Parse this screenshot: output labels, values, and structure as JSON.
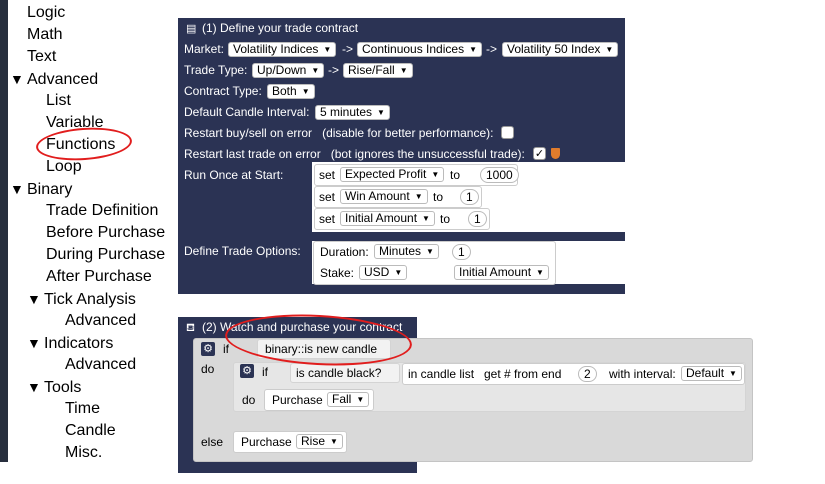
{
  "toolbox": {
    "items": [
      {
        "label": "Logic",
        "arrow": ""
      },
      {
        "label": "Math",
        "arrow": ""
      },
      {
        "label": "Text",
        "arrow": ""
      },
      {
        "label": "Advanced",
        "arrow": "▼"
      },
      {
        "label": "List",
        "arrow": ""
      },
      {
        "label": "Variable",
        "arrow": ""
      },
      {
        "label": "Functions",
        "arrow": ""
      },
      {
        "label": "Loop",
        "arrow": ""
      },
      {
        "label": "Binary",
        "arrow": "▼"
      },
      {
        "label": "Trade Definition",
        "arrow": ""
      },
      {
        "label": "Before Purchase",
        "arrow": ""
      },
      {
        "label": "During Purchase",
        "arrow": ""
      },
      {
        "label": "After Purchase",
        "arrow": ""
      },
      {
        "label": "Tick Analysis",
        "arrow": "▼"
      },
      {
        "label": "Advanced",
        "arrow": ""
      },
      {
        "label": "Indicators",
        "arrow": "▼"
      },
      {
        "label": "Advanced",
        "arrow": ""
      },
      {
        "label": "Tools",
        "arrow": "▼"
      },
      {
        "label": "Time",
        "arrow": ""
      },
      {
        "label": "Candle",
        "arrow": ""
      },
      {
        "label": "Misc.",
        "arrow": ""
      }
    ]
  },
  "trade": {
    "title": "(1) Define your trade contract",
    "market_label": "Market:",
    "market": [
      "Volatility Indices",
      "Continuous Indices",
      "Volatility 50 Index"
    ],
    "arrow": "->",
    "trade_type_label": "Trade Type:",
    "trade_type": [
      "Up/Down",
      "Rise/Fall"
    ],
    "contract_type_label": "Contract Type:",
    "contract_type": "Both",
    "candle_interval_label": "Default Candle Interval:",
    "candle_interval": "5 minutes",
    "restart_error_label": "Restart buy/sell on error",
    "restart_error_note": "(disable for better performance):",
    "restart_error_checked": "",
    "restart_last_label": "Restart last trade on error",
    "restart_last_note": "(bot ignores the unsuccessful trade):",
    "restart_last_checked": "✓",
    "run_once_label": "Run Once at Start:",
    "set_word": "set",
    "to_word": "to",
    "vars": [
      {
        "name": "Expected Profit",
        "value": "1000"
      },
      {
        "name": "Win Amount",
        "value": "1"
      },
      {
        "name": "Initial Amount",
        "value": "1"
      }
    ],
    "options_label": "Define Trade Options:",
    "duration_label": "Duration:",
    "duration_unit": "Minutes",
    "duration_value": "1",
    "stake_label": "Stake:",
    "stake_currency": "USD",
    "stake_amount": "Initial Amount"
  },
  "watch": {
    "title": "(2) Watch and purchase your contract",
    "if_word": "if",
    "do_word": "do",
    "else_word": "else",
    "condition": "binary::is new candle",
    "inner_condition": "is candle black?",
    "candle_list": "in candle list",
    "get_from_end": "get # from end",
    "index": "2",
    "with_interval": "with interval:",
    "interval": "Default",
    "purchase_word": "Purchase",
    "purchase_fall": "Fall",
    "purchase_rise": "Rise"
  }
}
